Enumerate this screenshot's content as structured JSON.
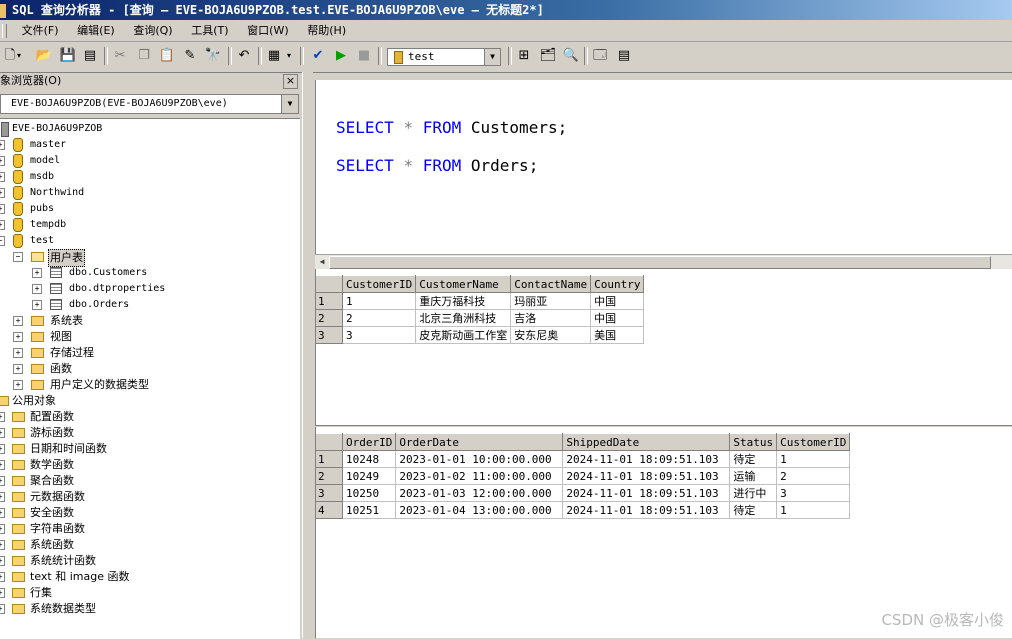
{
  "window": {
    "title": "SQL 查询分析器 - [查询 — EVE-BOJA6U9PZOB.test.EVE-BOJA6U9PZOB\\eve — 无标题2*]"
  },
  "menu": [
    "文件(F)",
    "编辑(E)",
    "查询(Q)",
    "工具(T)",
    "窗口(W)",
    "帮助(H)"
  ],
  "toolbar": {
    "database": "test",
    "icons": [
      "new-query-icon",
      "open-icon",
      "save-icon",
      "load-script-icon",
      "cut-icon",
      "copy-icon",
      "paste-icon",
      "clear-icon",
      "find-icon",
      "undo-icon",
      "results-mode-icon",
      "parse-icon",
      "execute-icon",
      "stop-icon",
      "database-icon",
      "display-plan-icon",
      "object-browser-icon",
      "object-search-icon",
      "options-icon",
      "results-pane-icon"
    ]
  },
  "object_browser": {
    "title": "象浏览器(O)",
    "close": "×",
    "server_combo": "EVE-BOJA6U9PZOB(EVE-BOJA6U9PZOB\\eve)",
    "server": "EVE-BOJA6U9PZOB",
    "databases": [
      "master",
      "model",
      "msdb",
      "Northwind",
      "pubs",
      "tempdb",
      "test"
    ],
    "user_tables_folder": "用户表",
    "tables": [
      "dbo.Customers",
      "dbo.dtproperties",
      "dbo.Orders"
    ],
    "test_folders": [
      "系统表",
      "视图",
      "存储过程",
      "函数",
      "用户定义的数据类型"
    ],
    "common_objects": "公用对象",
    "function_folders": [
      "配置函数",
      "游标函数",
      "日期和时间函数",
      "数学函数",
      "聚合函数",
      "元数据函数",
      "安全函数",
      "字符串函数",
      "系统函数",
      "系统统计函数",
      "text 和 image 函数",
      "行集",
      "系统数据类型"
    ]
  },
  "editor": {
    "lines": [
      {
        "kw1": "SELECT",
        "op": "*",
        "kw2": "FROM",
        "rest": "Customers;"
      },
      {
        "kw1": "SELECT",
        "op": "*",
        "kw2": "FROM",
        "rest": "Orders;"
      }
    ]
  },
  "results": {
    "customers": {
      "columns": [
        "CustomerID",
        "CustomerName",
        "ContactName",
        "Country"
      ],
      "rows": [
        [
          "1",
          "1",
          "重庆万福科技",
          "玛丽亚",
          "中国"
        ],
        [
          "2",
          "2",
          "北京三角洲科技",
          "吉洛",
          "中国"
        ],
        [
          "3",
          "3",
          "皮克斯动画工作室",
          "安东尼奥",
          "美国"
        ]
      ]
    },
    "orders": {
      "columns": [
        "OrderID",
        "OrderDate",
        "ShippedDate",
        "Status",
        "CustomerID"
      ],
      "rows": [
        [
          "1",
          "10248",
          "2023-01-01 10:00:00.000",
          "2024-11-01 18:09:51.103",
          "待定",
          "1"
        ],
        [
          "2",
          "10249",
          "2023-01-02 11:00:00.000",
          "2024-11-01 18:09:51.103",
          "运输",
          "2"
        ],
        [
          "3",
          "10250",
          "2023-01-03 12:00:00.000",
          "2024-11-01 18:09:51.103",
          "进行中",
          "3"
        ],
        [
          "4",
          "10251",
          "2023-01-04 13:00:00.000",
          "2024-11-01 18:09:51.103",
          "待定",
          "1"
        ]
      ]
    }
  },
  "watermark": "CSDN @极客小俊"
}
